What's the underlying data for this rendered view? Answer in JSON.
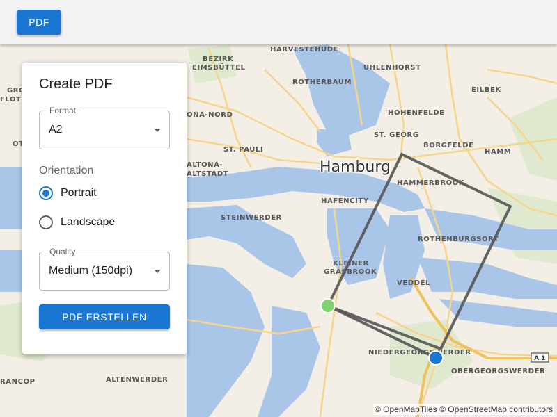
{
  "toolbar": {
    "pdf_button_label": "PDF"
  },
  "panel": {
    "title": "Create PDF",
    "format": {
      "label": "Format",
      "value": "A2"
    },
    "orientation": {
      "label": "Orientation",
      "options": [
        {
          "label": "Portrait",
          "selected": true
        },
        {
          "label": "Landscape",
          "selected": false
        }
      ]
    },
    "quality": {
      "label": "Quality",
      "value": "Medium (150dpi)"
    },
    "create_button_label": "PDF ERSTELLEN"
  },
  "map": {
    "city_label": "Hamburg",
    "district_labels": [
      "BEZIRK",
      "EIMSBÜTTEL",
      "HARVESTEHUDE",
      "UHLENHORST",
      "ROTHERBAUM",
      "EILBEK",
      "HOHENFELDE",
      "ONA-NORD",
      "ST. GEORG",
      "BORGFELDE",
      "ST. PAULI",
      "HAMM",
      "ALTONA-",
      "ALTSTADT",
      "HAMMERBROOK",
      "HAFENCITY",
      "STEINWERDER",
      "ROTHENBURGSORT",
      "KLEINER",
      "GRASBROOK",
      "VEDDEL",
      "NIEDERGEORGSWERDER",
      "OBERGEORGSWERDER",
      "ALTENWERDER",
      "RANCOP",
      "GRO",
      "FLOTT",
      "OT"
    ],
    "road_shield": "A 1",
    "attribution": "© OpenMapTiles © OpenStreetMap contributors"
  },
  "colors": {
    "accent": "#1976d2",
    "frame": "#555555",
    "handle_green": "#7ed56f",
    "handle_blue": "#1976d2",
    "water": "#a9c6e8"
  }
}
